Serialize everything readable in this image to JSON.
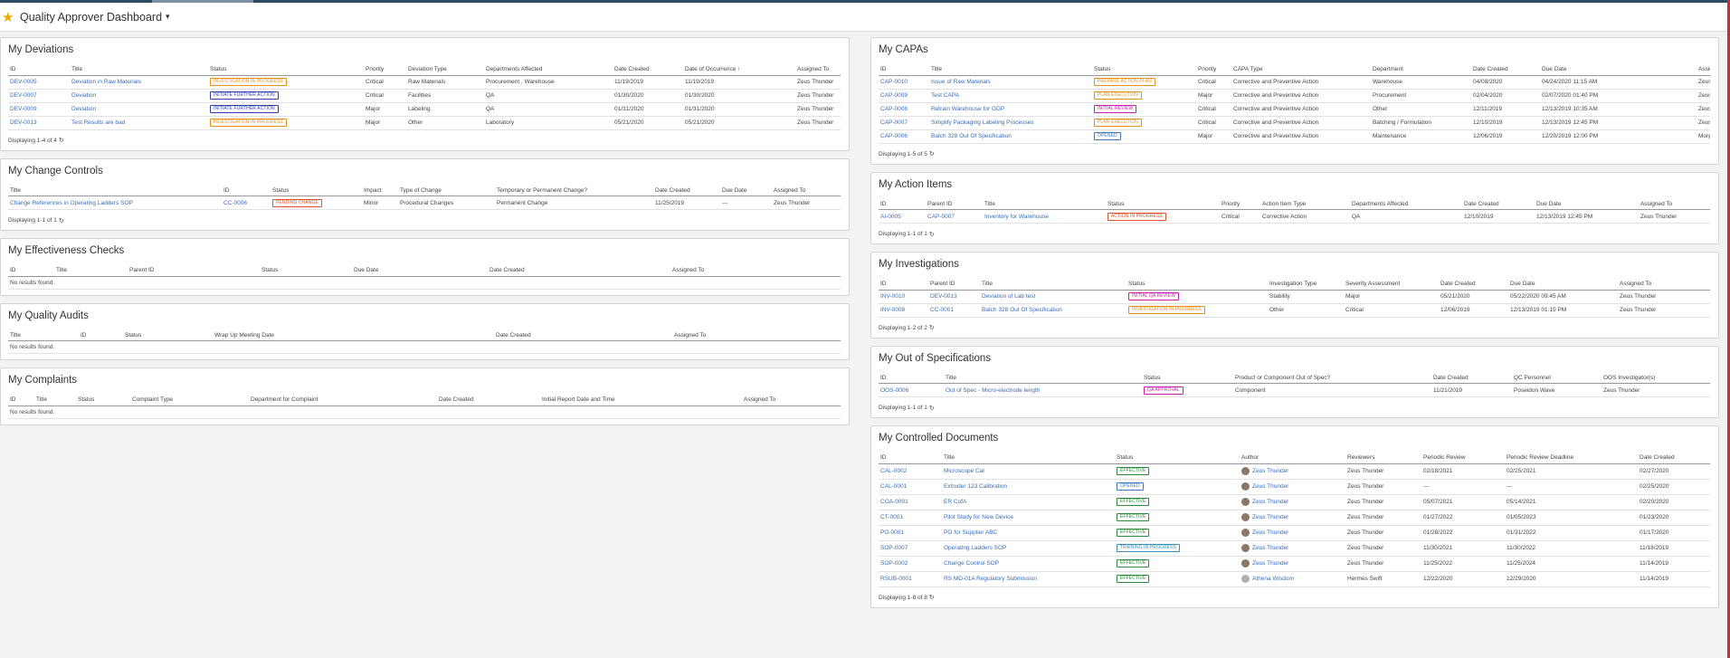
{
  "header": {
    "title": "Quality Approver Dashboard",
    "star_icon": "star-icon",
    "caret": "▾"
  },
  "refresh_icon": "↻",
  "deviations": {
    "title": "My Deviations",
    "columns": [
      "ID",
      "Title",
      "Status",
      "Priority",
      "Deviation Type",
      "Departments Affected",
      "Date Created",
      "Date of Occurrence",
      "Assigned To"
    ],
    "sort_indicator": "↑",
    "rows": [
      [
        "DEV-0005",
        "Deviation in Raw Materials",
        "INVESTIGATION IN PROGRESS",
        "Critical",
        "Raw Materials",
        "Procurement , Warehouse",
        "11/19/2019",
        "11/19/2019",
        "Zeus Thunder"
      ],
      [
        "DEV-0007",
        "Deviation",
        "INITIATE FURTHER ACTION",
        "Critical",
        "Facilities",
        "QA",
        "01/30/2020",
        "01/30/2020",
        "Zeus Thunder"
      ],
      [
        "DEV-0009",
        "Deviation",
        "INITIATE FURTHER ACTION",
        "Major",
        "Labeling",
        "QA",
        "01/31/2020",
        "01/31/2020",
        "Zeus Thunder"
      ],
      [
        "DEV-0013",
        "Test Results are bad",
        "INVESTIGATION IN PROGRESS",
        "Major",
        "Other",
        "Laboratory",
        "05/21/2020",
        "05/21/2020",
        "Zeus Thunder"
      ]
    ],
    "footer": "Displaying 1-4 of 4"
  },
  "change_controls": {
    "title": "My Change Controls",
    "columns": [
      "Title",
      "ID",
      "Status",
      "Impact",
      "Type of Change",
      "Temporary or Permanent Change?",
      "Date Created",
      "Due Date",
      "Assigned To"
    ],
    "rows": [
      [
        "Change References in Operating Ladders SOP",
        "CC-0006",
        "PENDING CHANGE",
        "Minor",
        "Procedural Changes",
        "Permanent Change",
        "11/25/2019",
        "---",
        "Zeus Thunder"
      ]
    ],
    "footer": "Displaying 1-1 of 1"
  },
  "effectiveness": {
    "title": "My Effectiveness Checks",
    "columns": [
      "ID",
      "Title",
      "Parent ID",
      "Status",
      "Due Date",
      "Date Created",
      "Assigned To"
    ],
    "empty": "No results found."
  },
  "audits": {
    "title": "My Quality Audits",
    "columns": [
      "Title",
      "ID",
      "Status",
      "Wrap Up Meeting Date",
      "Date Created",
      "Assigned To"
    ],
    "empty": "No results found."
  },
  "complaints": {
    "title": "My Complaints",
    "columns": [
      "ID",
      "Title",
      "Status",
      "Complaint Type",
      "Department for Complaint",
      "Date Created",
      "Initial Report Date and Time",
      "Assigned To"
    ],
    "empty": "No results found."
  },
  "capas": {
    "title": "My CAPAs",
    "columns": [
      "ID",
      "Title",
      "Status",
      "Priority",
      "CAPA Type",
      "Department",
      "Date Created",
      "Due Date",
      "Assigned To"
    ],
    "rows": [
      [
        "CAP-0010",
        "Issue of Raw Materials",
        "PREPARE ACTION PLAN",
        "Critical",
        "Corrective and Preventive Action",
        "Warehouse",
        "04/08/2020",
        "04/24/2020 11:15 AM",
        "Zeus Thunder"
      ],
      [
        "CAP-0009",
        "Test CAPA",
        "PLAN EXECUTION",
        "Major",
        "Corrective and Preventive Action",
        "Procurement",
        "02/04/2020",
        "02/07/2020 01:40 PM",
        "Zeus Thunder"
      ],
      [
        "CAP-0008",
        "Retrain Warehouse for GDP",
        "INITIAL REVIEW",
        "Critical",
        "Corrective and Preventive Action",
        "Other",
        "12/11/2019",
        "12/13/2019 10:35 AM",
        "Zeus Thunder"
      ],
      [
        "CAP-0007",
        "Simplify Packaging Labeling Processes",
        "PLAN EXECUTION",
        "Critical",
        "Corrective and Preventive Action",
        "Batching / Formulation",
        "12/10/2019",
        "12/13/2019 12:45 PM",
        "Zeus Thunder"
      ],
      [
        "CAP-0006",
        "Batch 328 Out Of Specification",
        "OPENED",
        "Major",
        "Corrective and Preventive Action",
        "Maintenance",
        "12/06/2019",
        "12/20/2019 12:00 PM",
        "Morpheus Dreams"
      ]
    ],
    "footer": "Displaying 1-5 of 5"
  },
  "action_items": {
    "title": "My Action Items",
    "columns": [
      "ID",
      "Parent ID",
      "Title",
      "Status",
      "Priority",
      "Action Item Type",
      "Departments Affected",
      "Date Created",
      "Due Date",
      "Assigned To"
    ],
    "rows": [
      [
        "AI-0005",
        "CAP-0007",
        "Inventory for Warehouse",
        "ACTION IN PROGRESS",
        "Critical",
        "Corrective Action",
        "QA",
        "12/10/2019",
        "12/13/2019 12:45 PM",
        "Zeus Thunder"
      ]
    ],
    "footer": "Displaying 1-1 of 1"
  },
  "investigations": {
    "title": "My Investigations",
    "columns": [
      "ID",
      "Parent ID",
      "Title",
      "Status",
      "Investigation Type",
      "Severity Assessment",
      "Date Created",
      "Due Date",
      "Assigned To"
    ],
    "rows": [
      [
        "INV-0010",
        "DEV-0013",
        "Deviation of Lab test",
        "INITIAL QA REVIEW",
        "Stability",
        "Major",
        "05/21/2020",
        "05/22/2020 09:45 AM",
        "Zeus Thunder"
      ],
      [
        "INV-0008",
        "CC-0001",
        "Batch 328 Out Of Specification",
        "INVESTIGATION IN PROGRESS",
        "Other",
        "Critical",
        "12/06/2019",
        "12/13/2019 01:15 PM",
        "Zeus Thunder"
      ]
    ],
    "footer": "Displaying 1-2 of 2"
  },
  "oos": {
    "title": "My Out of Specifications",
    "columns": [
      "ID",
      "Title",
      "Status",
      "Product or Component Out of Spec?",
      "Date Created",
      "QC Personnel",
      "OOS Investigator(s)"
    ],
    "rows": [
      [
        "OOS-0006",
        "Out of Spec - Micro-electrode length",
        "QA APPROVAL",
        "Component",
        "11/21/2019",
        "Poseidon Wave",
        "Zeus Thunder"
      ]
    ],
    "footer": "Displaying 1-1 of 1"
  },
  "documents": {
    "title": "My Controlled Documents",
    "columns": [
      "ID",
      "Title",
      "Status",
      "Author",
      "Reviewers",
      "Periodic Review",
      "Periodic Review Deadline",
      "Date Created"
    ],
    "rows": [
      [
        "CAL-0002",
        "Microscope Cal",
        "EFFECTIVE",
        "Zeus Thunder",
        "Zeus Thunder",
        "02/18/2021",
        "02/25/2021",
        "02/27/2020"
      ],
      [
        "CAL-0001",
        "Extruder 123 Calibration",
        "OPENED",
        "Zeus Thunder",
        "Zeus Thunder",
        "---",
        "---",
        "02/25/2020"
      ],
      [
        "COA-0001",
        "ER CofA",
        "EFFECTIVE",
        "Zeus Thunder",
        "Zeus Thunder",
        "05/07/2021",
        "05/14/2021",
        "02/20/2020"
      ],
      [
        "CT-0001",
        "Pilot Study for New Device",
        "EFFECTIVE",
        "Zeus Thunder",
        "Zeus Thunder",
        "01/27/2022",
        "01/05/2023",
        "01/23/2020"
      ],
      [
        "PO-0001",
        "PO for Supplier ABC",
        "EFFECTIVE",
        "Zeus Thunder",
        "Zeus Thunder",
        "01/28/2022",
        "01/31/2022",
        "01/17/2020"
      ],
      [
        "SOP-0007",
        "Operating Ladders SOP",
        "TRAINING IN PROGRESS",
        "Zeus Thunder",
        "Zeus Thunder",
        "11/30/2021",
        "11/30/2022",
        "11/18/2019"
      ],
      [
        "SOP-0002",
        "Change Control SOP",
        "EFFECTIVE",
        "Zeus Thunder",
        "Zeus Thunder",
        "11/25/2022",
        "11/25/2024",
        "11/14/2019"
      ],
      [
        "RSUB-0001",
        "RS MD-01A Regulatory Submission",
        "EFFECTIVE",
        "Athena Wisdom",
        "Hermes Swift",
        "12/22/2020",
        "12/29/2020",
        "11/14/2019"
      ]
    ],
    "footer": "Displaying 1-8 of 8"
  },
  "status_colors": {
    "INVESTIGATION IN PROGRESS": "#e8901c",
    "INITIATE FURTHER ACTION": "#2f3ea8",
    "PENDING CHANGE": "#d9532c",
    "PREPARE ACTION PLAN": "#e8901c",
    "PLAN EXECUTION": "#e8901c",
    "INITIAL REVIEW": "#c71fb0",
    "OPENED": "#3b78c4",
    "ACTION IN PROGRESS": "#d9532c",
    "INITIAL QA REVIEW": "#c71fb0",
    "QA APPROVAL": "#c71fb0",
    "EFFECTIVE": "#2c8a3a",
    "TRAINING IN PROGRESS": "#3a8fb7"
  }
}
